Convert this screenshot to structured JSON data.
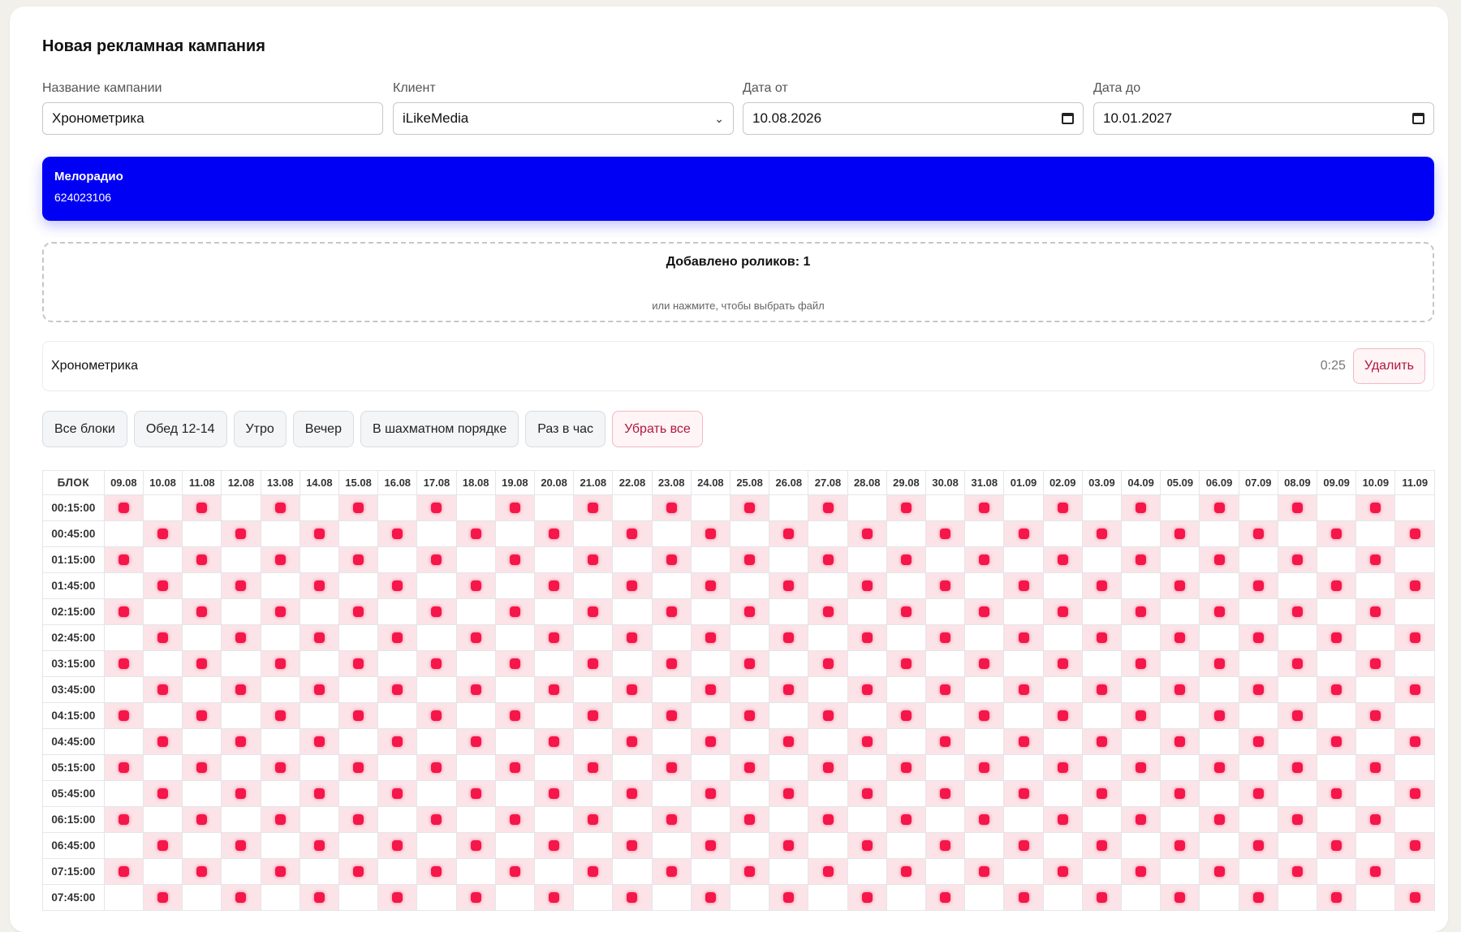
{
  "title": "Новая рекламная кампания",
  "form": {
    "name": {
      "label": "Название кампании",
      "value": "Хронометрика"
    },
    "client": {
      "label": "Клиент",
      "value": "iLikeMedia"
    },
    "date_from": {
      "label": "Дата от",
      "value": "10.08.2026"
    },
    "date_to": {
      "label": "Дата до",
      "value": "10.01.2027"
    }
  },
  "station": {
    "name": "Мелорадио",
    "id": "624023106"
  },
  "upload": {
    "title": "Добавлено роликов: 1",
    "hint": "или нажмите, чтобы выбрать файл"
  },
  "clip": {
    "name": "Хронометрика",
    "duration": "0:25",
    "delete_label": "Удалить"
  },
  "presets": [
    "Все блоки",
    "Обед 12-14",
    "Утро",
    "Вечер",
    "В шахматном порядке",
    "Раз в час",
    "Убрать все"
  ],
  "grid": {
    "corner": "БЛОК",
    "dates": [
      "09.08",
      "10.08",
      "11.08",
      "12.08",
      "13.08",
      "14.08",
      "15.08",
      "16.08",
      "17.08",
      "18.08",
      "19.08",
      "20.08",
      "21.08",
      "22.08",
      "23.08",
      "24.08",
      "25.08",
      "26.08",
      "27.08",
      "28.08",
      "29.08",
      "30.08",
      "31.08",
      "01.09",
      "02.09",
      "03.09",
      "04.09",
      "05.09",
      "06.09",
      "07.09",
      "08.09",
      "09.09",
      "10.09",
      "11.09"
    ],
    "times": [
      "00:15:00",
      "00:45:00",
      "01:15:00",
      "01:45:00",
      "02:15:00",
      "02:45:00",
      "03:15:00",
      "03:45:00",
      "04:15:00",
      "04:45:00",
      "05:15:00",
      "05:45:00",
      "06:15:00",
      "06:45:00",
      "07:15:00",
      "07:45:00"
    ],
    "pattern": "checkerboard",
    "colors": {
      "selected_bg": "#fbe3e7",
      "dot": "#f5164a"
    }
  },
  "colors": {
    "station_bg": "#0000f5",
    "danger": "#b0173a"
  }
}
